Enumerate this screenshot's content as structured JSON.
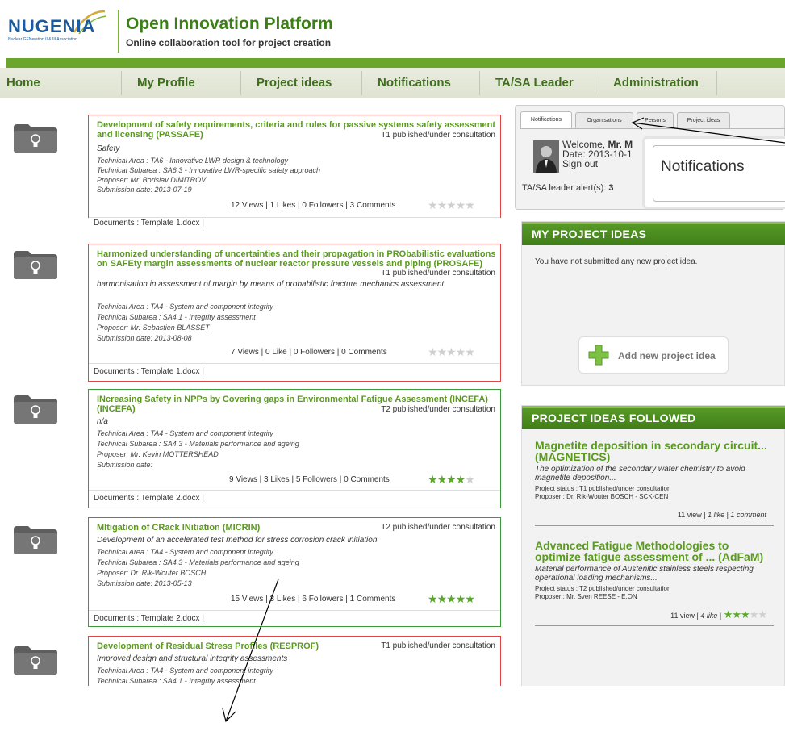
{
  "logo": {
    "word": "NUGENIA",
    "sub": "Nuclear GENeration II & III Association"
  },
  "site": {
    "title": "Open Innovation Platform",
    "tagline": "Online collaboration tool for project creation"
  },
  "nav": [
    "Home",
    "My Profile",
    "Project ideas",
    "Notifications",
    "TA/SA Leader",
    "Administration"
  ],
  "ideas": [
    {
      "title": "Development of safety requirements, criteria and rules for passive systems safety assessment and licensing (PASSAFE)",
      "status": "T1 published/under consultation",
      "description": "Safety",
      "area": "Technical Area : TA6 - Innovative LWR design & technology",
      "subarea": "Technical Subarea : SA6.3 - Innovative LWR-specific safety approach",
      "proposer": "Proposer: Mr. Borislav DIMITROV",
      "submission": "Submission date: 2013-07-19",
      "stats": "12 Views | 1 Likes | 0 Followers | 3 Comments",
      "rating": 0,
      "documents": "Documents : Template 1.docx |",
      "state": "red"
    },
    {
      "title": "Harmonized understanding of uncertainties and their propagation in PRObabilistic evaluations on SAFEty margin assessments of nuclear reactor pressure vessels and piping (PROSAFE)",
      "status": "T1 published/under consultation",
      "description": "harmonisation in assessment of margin by means of probabilistic fracture mechanics assessment",
      "area": "Technical Area : TA4 - System and component integrity",
      "subarea": "Technical Subarea : SA4.1 - Integrity assessment",
      "proposer": "Proposer: Mr. Sebastien BLASSET",
      "submission": "Submission date: 2013-08-08",
      "stats": "7 Views | 0 Like | 0 Followers | 0 Comments",
      "rating": 0,
      "documents": "Documents : Template 1.docx |",
      "state": "red"
    },
    {
      "title": "INcreasing Safety in NPPs by Covering gaps in Environmental Fatigue Assessment (INCEFA) (INCEFA)",
      "status": "T2 published/under consultation",
      "description": "n/a",
      "area": "Technical Area : TA4 - System and component integrity",
      "subarea": "Technical Subarea : SA4.3 - Materials performance and ageing",
      "proposer": "Proposer: Mr. Kevin MOTTERSHEAD",
      "submission": "Submission date:",
      "stats": "9 Views | 3 Likes | 5 Followers | 0 Comments",
      "rating": 4,
      "documents": "Documents : Template 2.docx |",
      "state": "green"
    },
    {
      "title": "MItigation of CRack INitiation (MICRIN)",
      "status": "T2 published/under consultation",
      "description": "Development of an accelerated test method for stress corrosion crack initiation",
      "area": "Technical Area : TA4 - System and component integrity",
      "subarea": "Technical Subarea : SA4.3 - Materials performance and ageing",
      "proposer": "Proposer: Dr. Rik-Wouter BOSCH",
      "submission": "Submission date: 2013-05-13",
      "stats": "15 Views | 3 Likes | 6 Followers | 1 Comments",
      "rating": 5,
      "documents": "Documents : Template 2.docx |",
      "state": "green"
    },
    {
      "title": "Development of Residual Stress Profiles (RESPROF)",
      "status": "T1 published/under consultation",
      "description": "Improved design and structural integrity assessments",
      "area": "Technical Area : TA4 - System and component integrity",
      "subarea": "Technical Subarea : SA4.1 - Integrity assessment",
      "state": "red"
    }
  ],
  "tabs": [
    "Notifications",
    "Organisations",
    "Persons",
    "Project ideas"
  ],
  "user": {
    "welcome_prefix": "Welcome, ",
    "welcome_name": "Mr. M",
    "date": "Date: 2013-10-1",
    "signout": "Sign out"
  },
  "alert": {
    "label": "TA/SA leader alert(s): ",
    "count": "3"
  },
  "popup": "Notifications",
  "my_ideas": {
    "heading": "MY PROJECT IDEAS",
    "empty": "You have not submitted any new project idea.",
    "add_label": "Add new project idea"
  },
  "followed": {
    "heading": "PROJECT IDEAS FOLLOWED",
    "items": [
      {
        "title": "Magnetite deposition in secondary circuit... (MAGNETICS)",
        "desc": "The optimization of the secondary water chemistry to avoid magnetite deposition...",
        "status": "Project status : T1 published/under consultation",
        "proposer": "Proposer : Dr. Rik-Wouter BOSCH - SCK-CEN",
        "views": "11 view",
        "likes": "1 like",
        "comments": "1 comment"
      },
      {
        "title": "Advanced Fatigue Methodologies to optimize fatigue assessment of ... (AdFaM)",
        "desc": "Material performance of Austenitic stainless steels respecting operational loading mechanisms...",
        "status": "Project status : T2 published/under consultation",
        "proposer": "Proposer : Mr. Sven REESE - E.ON",
        "views": "11 view",
        "likes": "4 like",
        "rating": 3
      }
    ]
  },
  "colors": {
    "brand_green": "#5a9a1e",
    "nav_text": "#3e6e1e",
    "border_red": "#e04646",
    "border_green": "#3c9a3c",
    "star_on": "#5aa82a",
    "star_off": "#cfcfcf"
  }
}
